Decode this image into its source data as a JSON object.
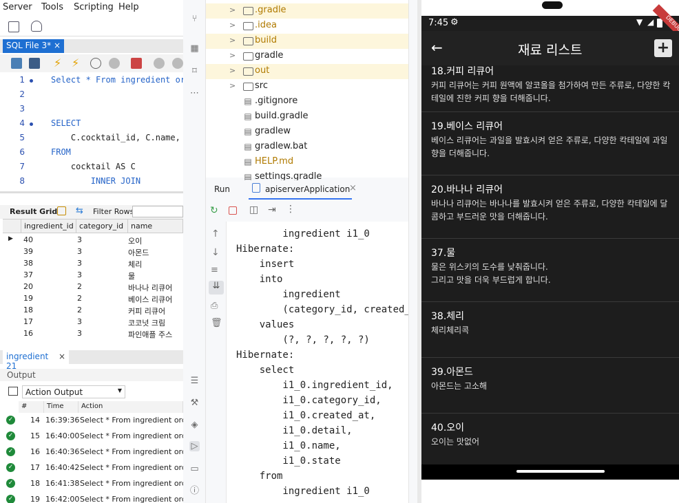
{
  "workbench": {
    "menu": [
      "Server",
      "Tools",
      "Scripting",
      "Help"
    ],
    "sql_tab": "SQL File 3*",
    "sql_tab_close": "×",
    "editor_lines": [
      {
        "num": "1",
        "code": "Select * From ingredient ord"
      },
      {
        "num": "2",
        "code": ""
      },
      {
        "num": "3",
        "code": ""
      },
      {
        "num": "4",
        "code": "SELECT"
      },
      {
        "num": "5",
        "code": "    C.cocktail_id, C.name, N"
      },
      {
        "num": "6",
        "code": "FROM"
      },
      {
        "num": "7",
        "code": "    cocktail AS C"
      },
      {
        "num": "8",
        "code": "        INNER JOIN"
      }
    ],
    "result_grid_label": "Result Grid",
    "filter_rows_label": "Filter Rows:",
    "columns": [
      "ingredient_id",
      "category_id",
      "name"
    ],
    "rows": [
      {
        "id": "40",
        "cat": "3",
        "name": "오이"
      },
      {
        "id": "39",
        "cat": "3",
        "name": "아몬드"
      },
      {
        "id": "38",
        "cat": "3",
        "name": "체리"
      },
      {
        "id": "37",
        "cat": "3",
        "name": "물"
      },
      {
        "id": "20",
        "cat": "2",
        "name": "바나나 리큐어"
      },
      {
        "id": "19",
        "cat": "2",
        "name": "베이스 리큐어"
      },
      {
        "id": "18",
        "cat": "2",
        "name": "커피 리큐어"
      },
      {
        "id": "17",
        "cat": "3",
        "name": "코코넛 크림"
      },
      {
        "id": "16",
        "cat": "3",
        "name": "파인애플 주스"
      }
    ],
    "result_tab": "ingredient 21",
    "output_label": "Output",
    "action_output": "Action Output",
    "out_columns": [
      "#",
      "Time",
      "Action"
    ],
    "out_rows": [
      {
        "n": "14",
        "time": "16:39:36",
        "action": "Select * From ingredient order by"
      },
      {
        "n": "15",
        "time": "16:40:00",
        "action": "Select * From ingredient order by"
      },
      {
        "n": "16",
        "time": "16:40:36",
        "action": "Select * From ingredient order by"
      },
      {
        "n": "17",
        "time": "16:40:42",
        "action": "Select * From ingredient order by"
      },
      {
        "n": "18",
        "time": "16:41:38",
        "action": "Select * From ingredient order by"
      },
      {
        "n": "19",
        "time": "16:42:00",
        "action": "Select * From ingredient order by"
      }
    ]
  },
  "ide": {
    "tree": [
      {
        "name": ".gradle",
        "type": "folder",
        "color": "#b07a00"
      },
      {
        "name": ".idea",
        "type": "folder",
        "color": "#b07a00"
      },
      {
        "name": "build",
        "type": "folder",
        "color": "#b07a00"
      },
      {
        "name": "gradle",
        "type": "folder",
        "color": "#222222"
      },
      {
        "name": "out",
        "type": "folder",
        "color": "#b07a00"
      },
      {
        "name": "src",
        "type": "folder",
        "color": "#222222"
      },
      {
        "name": ".gitignore",
        "type": "file",
        "color": "#222222"
      },
      {
        "name": "build.gradle",
        "type": "file",
        "color": "#222222"
      },
      {
        "name": "gradlew",
        "type": "file",
        "color": "#222222"
      },
      {
        "name": "gradlew.bat",
        "type": "file",
        "color": "#222222"
      },
      {
        "name": "HELP.md",
        "type": "file",
        "color": "#b07a00"
      },
      {
        "name": "settings.gradle",
        "type": "file",
        "color": "#222222"
      }
    ],
    "run_label": "Run",
    "run_config": "apiserverApplication",
    "console_lines": [
      "        from",
      "        ingredient i1_0",
      "Hibernate:",
      "    insert",
      "    into",
      "        ingredient",
      "        (category_id, created_at",
      "    values",
      "        (?, ?, ?, ?, ?)",
      "Hibernate:",
      "    select",
      "        i1_0.ingredient_id,",
      "        i1_0.category_id,",
      "        i1_0.created_at,",
      "        i1_0.detail,",
      "        i1_0.name,",
      "        i1_0.state",
      "    from",
      "        ingredient i1_0"
    ]
  },
  "phone": {
    "time": "7:45",
    "title": "재료 리스트",
    "debug_banner": "DEBUG",
    "items": [
      {
        "title": "18.커피 리큐어",
        "desc": "커피 리큐어는 커피 원액에 알코올을 첨가하여 만든 주류로, 다양한 칵테일에 진한 커피 향을 더해줍니다."
      },
      {
        "title": "19.베이스 리큐어",
        "desc": "베이스 리큐어는 과일을 발효시켜 얻은 주류로, 다양한 칵테일에 과일 향을 더해줍니다."
      },
      {
        "title": "20.바나나 리큐어",
        "desc": "바나나 리큐어는 바나나를 발효시켜 얻은 주류로, 다양한 칵테일에 달콤하고 부드러운 맛을 더해줍니다."
      },
      {
        "title": "37.물",
        "desc": "물은 위스키의 도수를 낮춰줍니다.\n그리고 맛을 더욱 부드럽게 합니다."
      },
      {
        "title": "38.체리",
        "desc": "체리체리콕"
      },
      {
        "title": "39.아몬드",
        "desc": "아몬드는 고소해"
      },
      {
        "title": "40.오이",
        "desc": "오이는 맛없어"
      }
    ]
  }
}
